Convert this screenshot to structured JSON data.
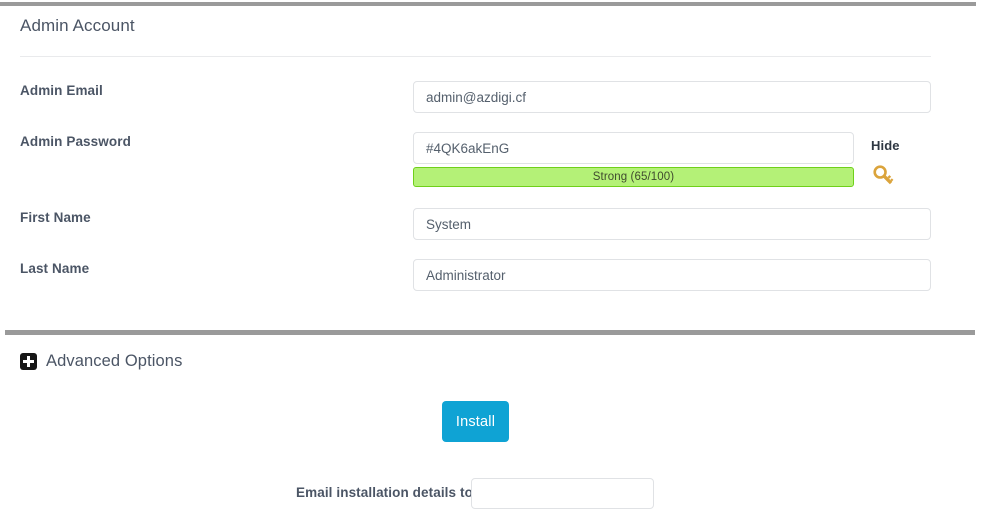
{
  "section": {
    "title": "Admin Account"
  },
  "fields": {
    "admin_email": {
      "label": "Admin Email",
      "value": "admin@azdigi.cf",
      "placeholder": ""
    },
    "admin_password": {
      "label": "Admin Password",
      "value": "#4QK6akEnG",
      "placeholder": "",
      "strength_text": "Strong (65/100)",
      "strength_score": 65,
      "strength_max": 100,
      "strength_level": "Strong",
      "toggle_label": "Hide",
      "generate_icon": "key-icon"
    },
    "first_name": {
      "label": "First Name",
      "value": "System",
      "placeholder": ""
    },
    "last_name": {
      "label": "Last Name",
      "value": "Administrator",
      "placeholder": ""
    }
  },
  "advanced": {
    "label": "Advanced Options",
    "toggle_icon": "plus-square-icon",
    "expanded": false
  },
  "actions": {
    "install_label": "Install"
  },
  "email_details": {
    "label": "Email installation details to :",
    "value": "",
    "placeholder": ""
  },
  "colors": {
    "rule": "#9a9a9a",
    "hairline": "#e9eaec",
    "label_text": "#4b5565",
    "input_border": "#e0e2e5",
    "strength_fill": "#b4f177",
    "strength_border": "#6fd01a",
    "install_button": "#0fa3d4",
    "key_icon": "#d9a236"
  }
}
